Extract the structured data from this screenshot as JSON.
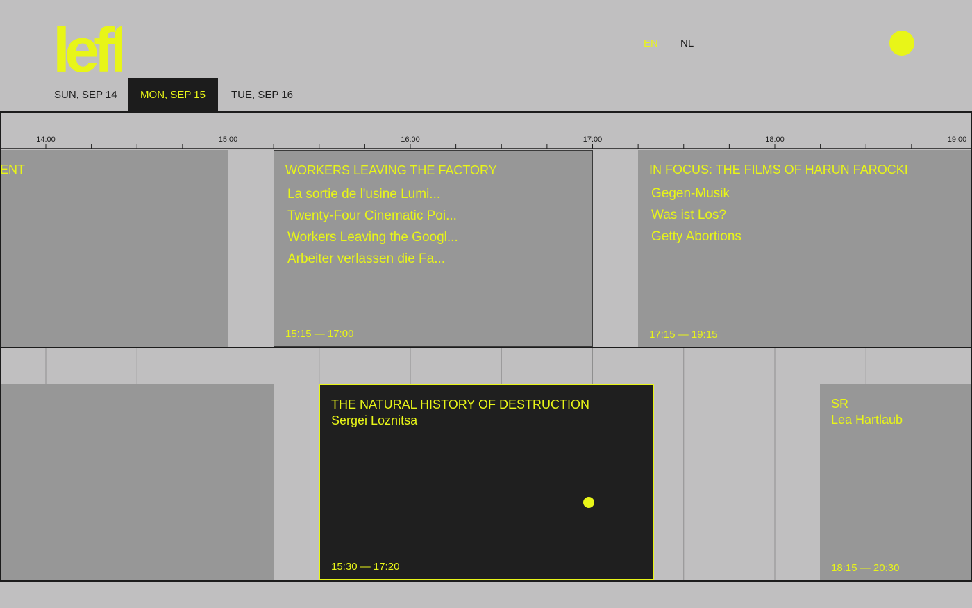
{
  "brand": {
    "logo_text": "leff",
    "accent": "#e8f518",
    "dark": "#1c1c1c",
    "background": "#c0bfc0",
    "card": "#979797"
  },
  "header": {
    "languages": [
      {
        "label": "EN",
        "active": true
      },
      {
        "label": "NL",
        "active": false
      }
    ],
    "status_dot": "yellow-dot"
  },
  "tabs": [
    {
      "label": "SUN, SEP 14",
      "active": false
    },
    {
      "label": "MON, SEP 15",
      "active": true
    },
    {
      "label": "TUE, SEP 16",
      "active": false
    }
  ],
  "timeline": {
    "hours": [
      "14:00",
      "15:00",
      "16:00",
      "17:00",
      "18:00",
      "19:00"
    ],
    "ticks_per_hour": 4
  },
  "rows": [
    {
      "events": [
        {
          "title": "ENT",
          "time": ""
        },
        {
          "title": "WORKERS LEAVING THE FACTORY",
          "time": "15:15 — 17:00",
          "films": [
            "La sortie de l'usine Lumi...",
            "Twenty-Four Cinematic Poi...",
            "Workers Leaving the Googl...",
            "Arbeiter verlassen die Fa..."
          ]
        },
        {
          "title": "IN FOCUS: THE FILMS OF HARUN FAROCKI",
          "time": "17:15 — 19:15",
          "films": [
            "Gegen-Musik",
            "Was ist Los?",
            "Getty Abortions"
          ]
        }
      ]
    },
    {
      "events": [
        {
          "title": "",
          "time": ""
        },
        {
          "title": "THE NATURAL HISTORY OF DESTRUCTION",
          "director": "Sergei Loznitsa",
          "time": "15:30 — 17:20"
        },
        {
          "title": "SR",
          "director": "Lea Hartlaub",
          "time": "18:15 — 20:30"
        }
      ]
    }
  ]
}
